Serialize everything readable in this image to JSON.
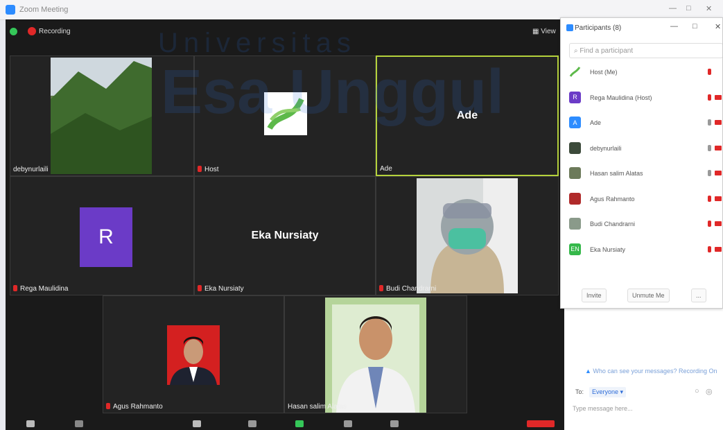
{
  "window": {
    "title": "Zoom Meeting"
  },
  "meeting": {
    "recording_label": "Recording",
    "view_label": "View"
  },
  "tiles": {
    "debynurlaili": {
      "name": "debynurlaili"
    },
    "host": {
      "name": "Host"
    },
    "ade": {
      "name": "Ade",
      "display": "Ade"
    },
    "rega": {
      "name": "Rega Maulidina",
      "initial": "R"
    },
    "eka": {
      "name": "Eka Nursiaty",
      "display": "Eka Nursiaty"
    },
    "budi": {
      "name": "Budi Chandrarni"
    },
    "agus": {
      "name": "Agus Rahmanto"
    },
    "hasan": {
      "name": "Hasan salim Alatas"
    }
  },
  "participants": {
    "title": "Participants (8)",
    "search_placeholder": "Find a participant",
    "list": [
      {
        "name": "Host (Me)",
        "avatar": "",
        "color": "#ffffff",
        "mic": "muted",
        "cam": "none"
      },
      {
        "name": "Rega Maulidina (Host)",
        "avatar": "R",
        "color": "#6b3bc7",
        "mic": "muted",
        "cam": "off"
      },
      {
        "name": "Ade",
        "avatar": "A",
        "color": "#2d8cff",
        "mic": "on",
        "cam": "off"
      },
      {
        "name": "debynurlaili",
        "avatar": "",
        "color": "#3c4a3a",
        "mic": "on",
        "cam": "off"
      },
      {
        "name": "Hasan salim Alatas",
        "avatar": "",
        "color": "#6c7a5a",
        "mic": "on",
        "cam": "off"
      },
      {
        "name": "Agus Rahmanto",
        "avatar": "",
        "color": "#b02a2a",
        "mic": "muted",
        "cam": "off"
      },
      {
        "name": "Budi Chandrarni",
        "avatar": "",
        "color": "#8a9a8a",
        "mic": "muted",
        "cam": "off"
      },
      {
        "name": "Eka Nursiaty",
        "avatar": "EN",
        "color": "#35b84a",
        "mic": "muted",
        "cam": "off"
      }
    ],
    "invite_label": "Invite",
    "unmute_label": "Unmute Me",
    "more_label": "..."
  },
  "chat": {
    "who_can_see": "Who can see your messages? Recording On",
    "to_label": "To:",
    "recipient": "Everyone",
    "placeholder": "Type message here..."
  },
  "watermark": {
    "line1": "Universitas",
    "line2": "Esa Unggul"
  },
  "colors": {
    "accent": "#2d8cff",
    "active_speaker": "#b5d23c",
    "muted": "#e02828",
    "recording": "#e02828"
  }
}
